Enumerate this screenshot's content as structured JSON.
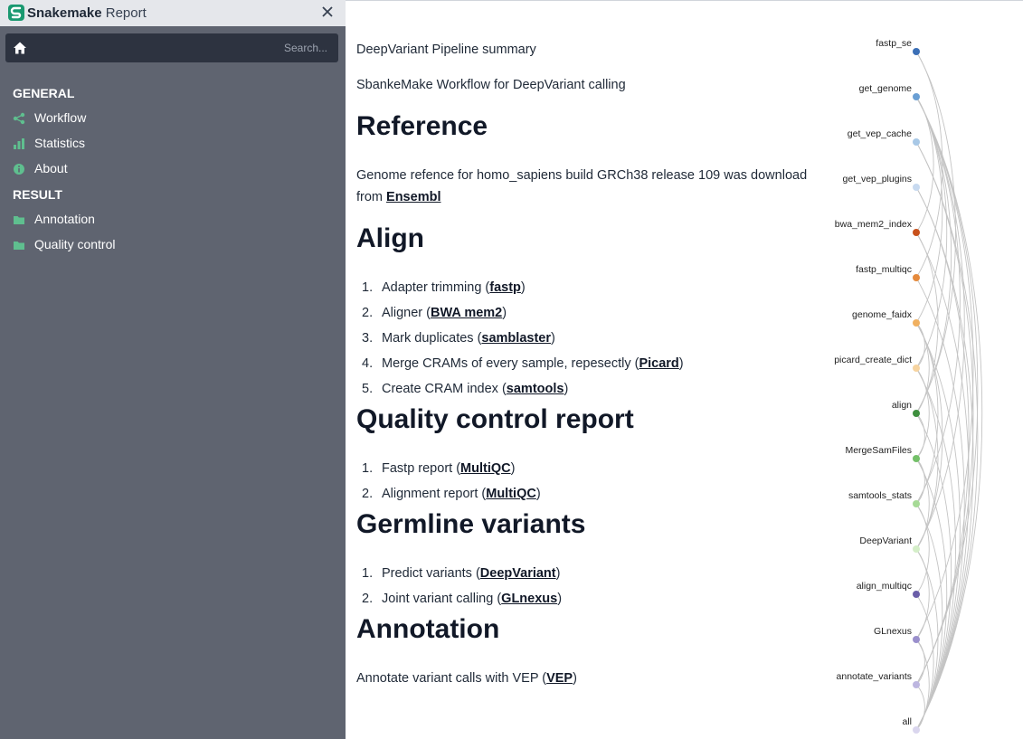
{
  "window": {
    "title_bold": "Snakemake",
    "title_rest": " Report"
  },
  "search": {
    "placeholder": "Search..."
  },
  "sidebar": {
    "general_heading": "GENERAL",
    "general_items": [
      {
        "label": "Workflow",
        "icon": "share-icon"
      },
      {
        "label": "Statistics",
        "icon": "bar-chart-icon"
      },
      {
        "label": "About",
        "icon": "info-icon"
      }
    ],
    "result_heading": "RESULT",
    "result_items": [
      {
        "label": "Annotation",
        "icon": "folder-icon"
      },
      {
        "label": "Quality control",
        "icon": "folder-icon"
      }
    ]
  },
  "content": {
    "summary_title": "DeepVariant Pipeline summary",
    "summary_desc": "SbankeMake Workflow for DeepVariant calling",
    "reference": {
      "heading": "Reference",
      "text_line1": "Genome refence for homo_sapiens build GRCh38 release 109 was download",
      "text_line2_prefix": "from ",
      "link": "Ensembl"
    },
    "align": {
      "heading": "Align",
      "items": [
        {
          "num": "1.",
          "prefix": "Adapter trimming (",
          "link": "fastp",
          "suffix": ")"
        },
        {
          "num": "2.",
          "prefix": "Aligner (",
          "link": "BWA mem2",
          "suffix": ")"
        },
        {
          "num": "3.",
          "prefix": "Mark duplicates (",
          "link": "samblaster",
          "suffix": ")"
        },
        {
          "num": "4.",
          "prefix": "Merge CRAMs of every sample, repesectly (",
          "link": "Picard",
          "suffix": ")"
        },
        {
          "num": "5.",
          "prefix": "Create CRAM index (",
          "link": "samtools",
          "suffix": ")"
        }
      ]
    },
    "qc": {
      "heading": "Quality control report",
      "items": [
        {
          "num": "1.",
          "prefix": "Fastp report (",
          "link": "MultiQC",
          "suffix": ")"
        },
        {
          "num": "2.",
          "prefix": "Alignment report (",
          "link": "MultiQC",
          "suffix": ")"
        }
      ]
    },
    "germline": {
      "heading": "Germline variants",
      "items": [
        {
          "num": "1.",
          "prefix": "Predict variants (",
          "link": "DeepVariant",
          "suffix": ")"
        },
        {
          "num": "2.",
          "prefix": "Joint variant calling (",
          "link": "GLnexus",
          "suffix": ")"
        }
      ]
    },
    "annotation": {
      "heading": "Annotation",
      "text_prefix": "Annotate variant calls with VEP (",
      "link": "VEP",
      "text_suffix": ")"
    }
  },
  "dag": {
    "nodes": [
      {
        "label": "fastp_se",
        "color": "#3b6fb6"
      },
      {
        "label": "get_genome",
        "color": "#6a9fd4"
      },
      {
        "label": "get_vep_cache",
        "color": "#a8c8e6"
      },
      {
        "label": "get_vep_plugins",
        "color": "#c8daf0"
      },
      {
        "label": "bwa_mem2_index",
        "color": "#c8511c"
      },
      {
        "label": "fastp_multiqc",
        "color": "#e58a3c"
      },
      {
        "label": "genome_faidx",
        "color": "#f0b060"
      },
      {
        "label": "picard_create_dict",
        "color": "#f7d4a0"
      },
      {
        "label": "align",
        "color": "#3e8f3e"
      },
      {
        "label": "MergeSamFiles",
        "color": "#74c069"
      },
      {
        "label": "samtools_stats",
        "color": "#a6da96"
      },
      {
        "label": "DeepVariant",
        "color": "#d4eec8"
      },
      {
        "label": "align_multiqc",
        "color": "#6a5ea8"
      },
      {
        "label": "GLnexus",
        "color": "#9a8fcc"
      },
      {
        "label": "annotate_variants",
        "color": "#bdb6e0"
      },
      {
        "label": "all",
        "color": "#dad6ee"
      }
    ],
    "edges": [
      [
        0,
        5
      ],
      [
        0,
        8
      ],
      [
        1,
        4
      ],
      [
        1,
        6
      ],
      [
        1,
        7
      ],
      [
        1,
        8
      ],
      [
        1,
        10
      ],
      [
        1,
        11
      ],
      [
        1,
        13
      ],
      [
        1,
        14
      ],
      [
        1,
        15
      ],
      [
        2,
        14
      ],
      [
        2,
        15
      ],
      [
        3,
        14
      ],
      [
        3,
        15
      ],
      [
        4,
        8
      ],
      [
        4,
        15
      ],
      [
        5,
        15
      ],
      [
        6,
        7
      ],
      [
        6,
        8
      ],
      [
        6,
        10
      ],
      [
        6,
        11
      ],
      [
        6,
        15
      ],
      [
        7,
        9
      ],
      [
        7,
        11
      ],
      [
        7,
        15
      ],
      [
        8,
        9
      ],
      [
        8,
        15
      ],
      [
        9,
        10
      ],
      [
        9,
        11
      ],
      [
        9,
        15
      ],
      [
        10,
        12
      ],
      [
        10,
        15
      ],
      [
        11,
        13
      ],
      [
        11,
        15
      ],
      [
        12,
        15
      ],
      [
        13,
        14
      ],
      [
        13,
        15
      ],
      [
        14,
        15
      ]
    ]
  }
}
